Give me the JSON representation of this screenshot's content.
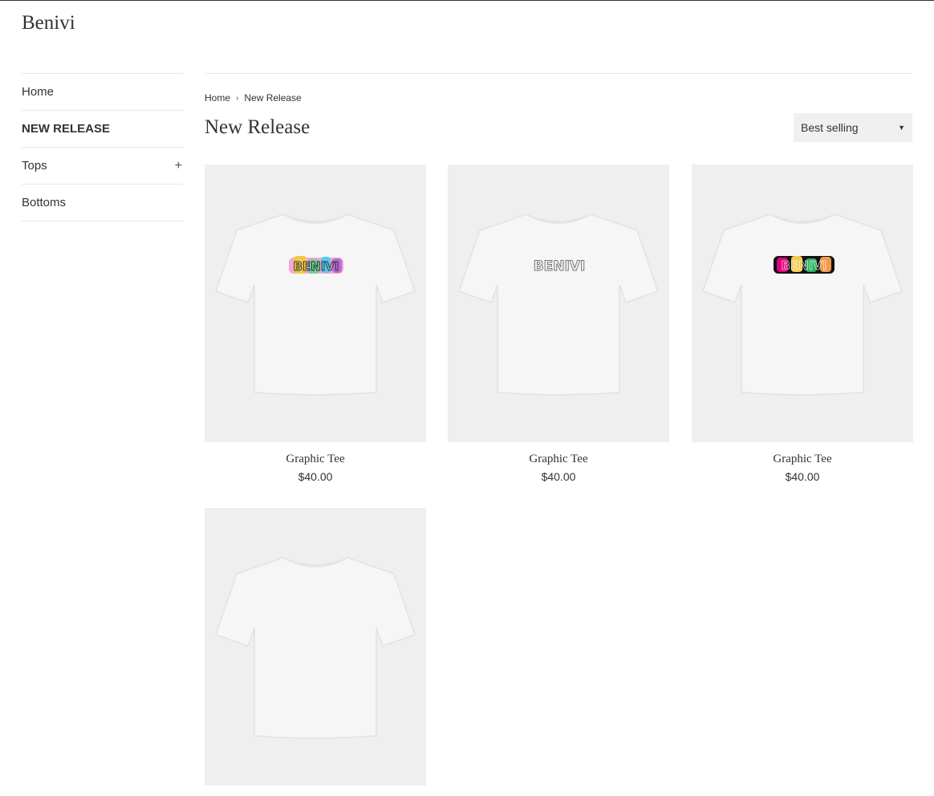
{
  "store": {
    "name": "Benivi"
  },
  "sidebar": {
    "items": [
      {
        "label": "Home",
        "active": false,
        "expandable": false
      },
      {
        "label": "NEW RELEASE",
        "active": true,
        "expandable": false
      },
      {
        "label": "Tops",
        "active": false,
        "expandable": true,
        "expand_symbol": "+"
      },
      {
        "label": "Bottoms",
        "active": false,
        "expandable": false
      }
    ]
  },
  "breadcrumb": {
    "home": "Home",
    "separator": "›",
    "current": "New Release"
  },
  "collection": {
    "title": "New Release"
  },
  "sort": {
    "selected": "Best selling",
    "icon": "caret-down-icon"
  },
  "products": [
    {
      "name": "Graphic Tee",
      "price": "$40.00",
      "logo_text": "BENIVI",
      "logo_style": "multicolor"
    },
    {
      "name": "Graphic Tee",
      "price": "$40.00",
      "logo_text": "BENIVI",
      "logo_style": "outline-gray"
    },
    {
      "name": "Graphic Tee",
      "price": "$40.00",
      "logo_text": "BENIVI",
      "logo_style": "multicolor-dark"
    },
    {
      "name": "",
      "price": "",
      "logo_text": "",
      "logo_style": "partial"
    }
  ],
  "colors": {
    "accent": "#333333",
    "image_bg": "#efefef",
    "rule": "#e8e8e8"
  }
}
